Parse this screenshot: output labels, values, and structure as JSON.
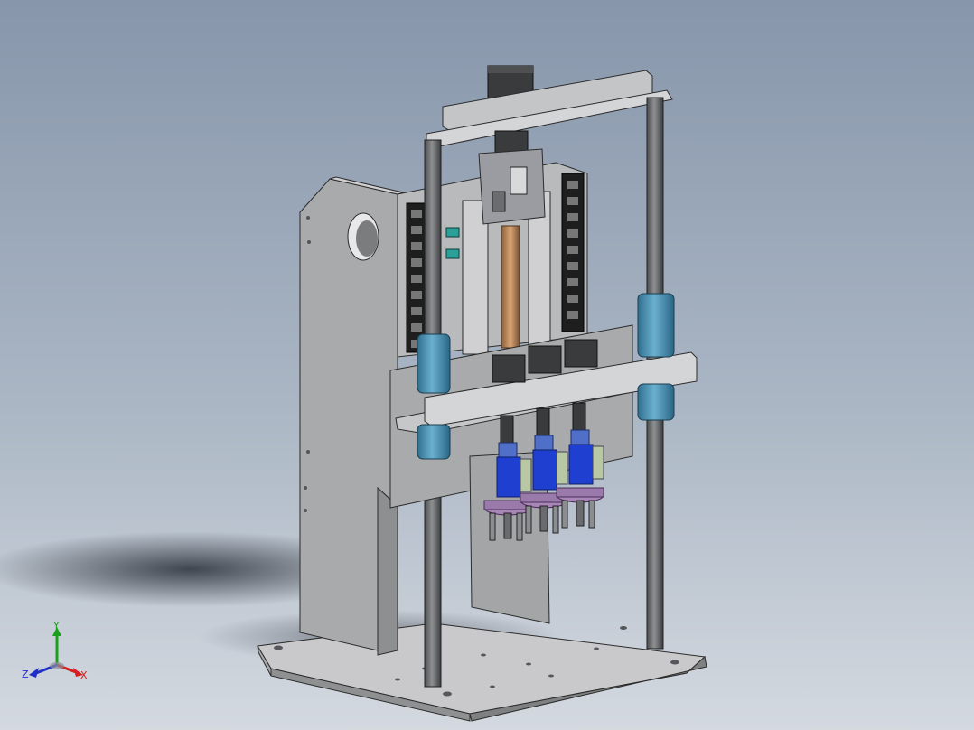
{
  "viewport": {
    "background_top": "#8796ab",
    "background_bottom": "#d4d9e0",
    "model_name": ""
  },
  "triad": {
    "x_label": "X",
    "y_label": "Y",
    "z_label": "Z",
    "x_color": "#d42020",
    "y_color": "#1aa01a",
    "z_color": "#1f2fc8"
  }
}
